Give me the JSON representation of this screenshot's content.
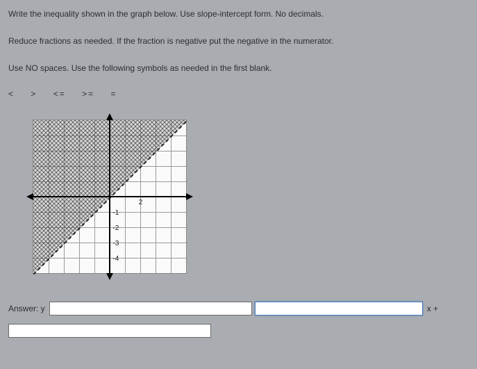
{
  "instructions": {
    "line1": "Write the inequality shown in the graph below.  Use slope-intercept form.  No decimals.",
    "line2": "Reduce fractions as needed.  If the fraction is negative put the negative in the numerator.",
    "line3": "Use NO spaces.  Use the following symbols as needed in the first blank."
  },
  "symbols": {
    "lt": "<",
    "gt": ">",
    "lte": "<=",
    "gte": ">=",
    "eq": "="
  },
  "axis_labels": {
    "x2": "2",
    "yn1": "-1",
    "yn2": "-2",
    "yn3": "-3",
    "yn4": "-4"
  },
  "answer": {
    "prefix": "Answer: y",
    "input1": "",
    "input2": "",
    "suffix": "x +",
    "input3": ""
  },
  "chart_data": {
    "type": "inequality_graph",
    "xlim": [
      -5,
      5
    ],
    "ylim": [
      -5,
      5
    ],
    "boundary_line": {
      "slope": 1,
      "intercept": 0,
      "style": "dashed"
    },
    "shaded_region": "above",
    "visible_ticks": {
      "x": [
        2
      ],
      "y": [
        -1,
        -2,
        -3,
        -4
      ]
    }
  }
}
